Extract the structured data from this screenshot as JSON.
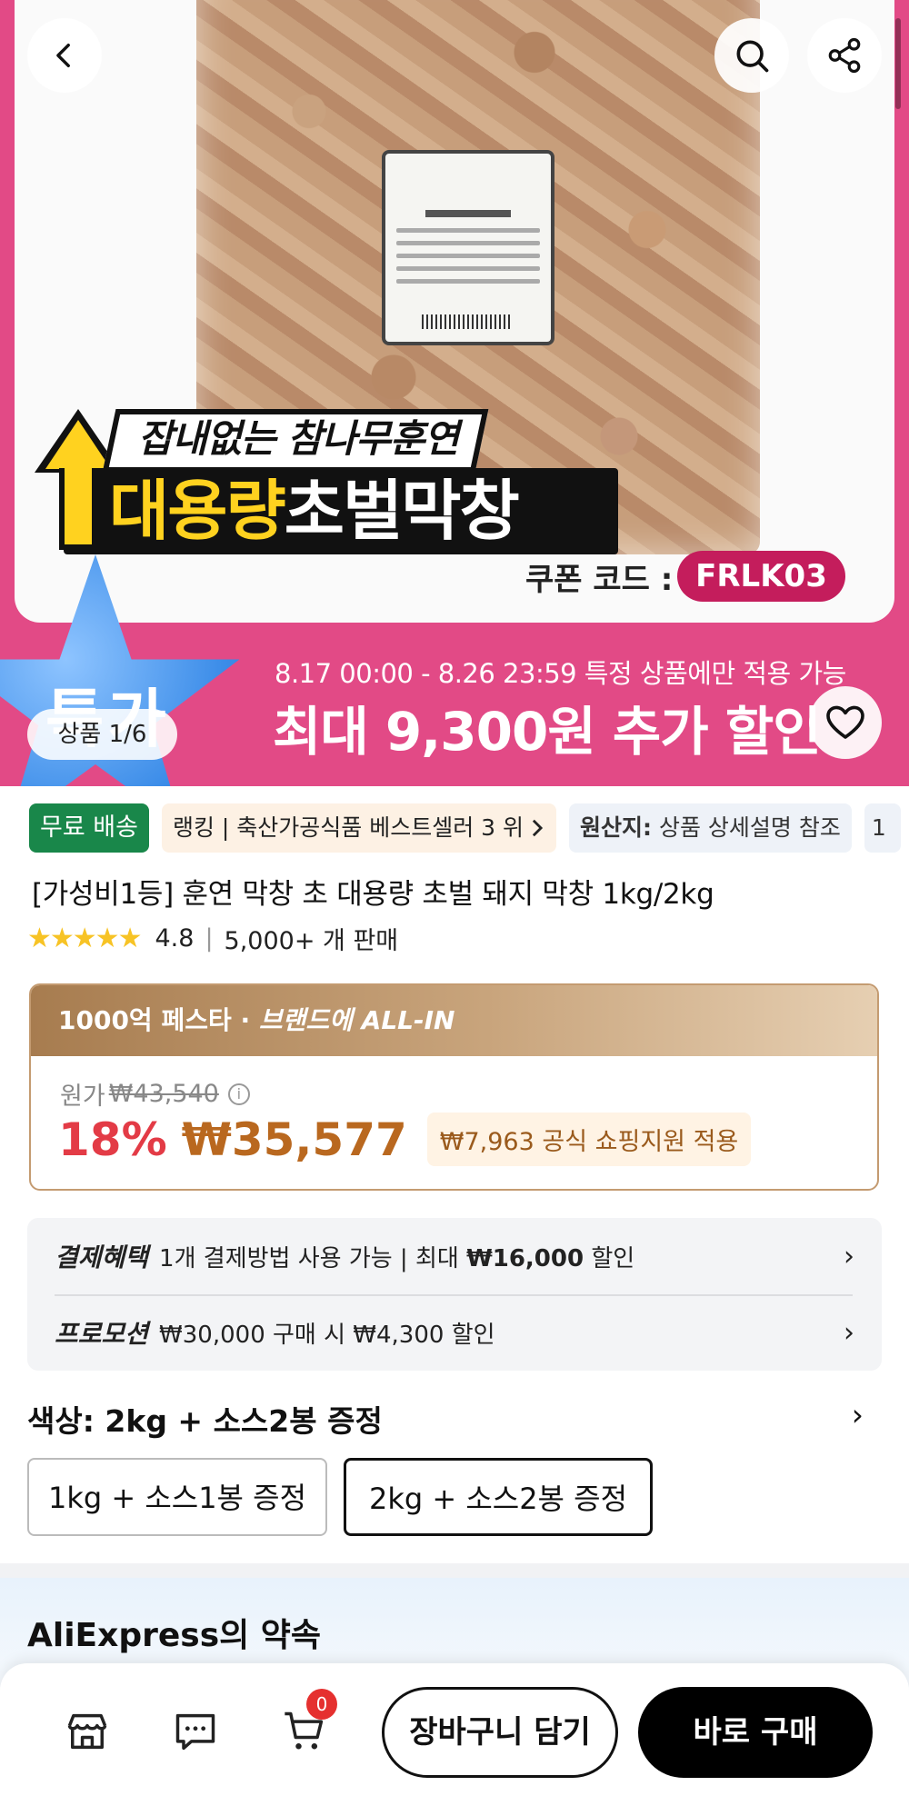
{
  "hero": {
    "headline_small": "잡내없는 참나무훈연",
    "headline_yellow": "대용량",
    "headline_white": "초벌막창",
    "coupon_label": "쿠폰 코드 :",
    "coupon_code": "FRLK03",
    "star_text": "특가",
    "promo_date": "8.17 00:00 - 8.26 23:59 특정 상품에만 적용 가능",
    "promo_big": "최대 9,300원 추가 할인",
    "image_counter": "상품 1/6",
    "colors": {
      "background": "#e24a86",
      "coupon": "#c41d5c",
      "headline_yellow": "#ffd21f"
    }
  },
  "icons": {
    "back": "chevron-left-icon",
    "search": "search-icon",
    "share": "share-icon",
    "wishlist": "heart-icon",
    "store": "store-icon",
    "chat": "chat-icon",
    "cart": "cart-icon"
  },
  "tags": {
    "free_shipping": "무료 배송",
    "ranking": "랭킹 | 축산가공식품 베스트셀러 3 위",
    "origin_label": "원산지:",
    "origin_value": "상품 상세설명 참조",
    "more": "1"
  },
  "product": {
    "title": "[가성비1등] 훈연 막창 초 대용량 초벌 돼지 막창 1kg/2kg",
    "rating": "4.8",
    "rating_stars": 4.8,
    "sold": "5,000+ 개 판매"
  },
  "price": {
    "festa_prefix": "1000억 페스타 · ",
    "festa_brand": "브랜드에 ALL-IN",
    "original_label": "원가",
    "original_price": "₩43,540",
    "discount": "18%",
    "current_price": "₩35,577",
    "support": "₩7,963 공식 쇼핑지원 적용",
    "colors": {
      "discount": "#e33b46",
      "price": "#b9681f"
    }
  },
  "benefits": {
    "payment_label": "결제혜택",
    "payment_text_1": "1개 결제방법 사용 가능 | 최대 ",
    "payment_amount": "₩16,000",
    "payment_text_2": " 할인",
    "promotion_label": "프로모션",
    "promotion_text": "₩30,000 구매 시 ₩4,300 할인"
  },
  "options": {
    "heading": "색상: 2kg + 소스2봉 증정",
    "items": [
      "1kg + 소스1봉 증정",
      "2kg + 소스2봉 증정"
    ],
    "selected": "2kg + 소스2봉 증정"
  },
  "promise": {
    "title": "AliExpress의 약속"
  },
  "bottom_bar": {
    "cart_count": "0",
    "add_to_cart": "장바구니 담기",
    "buy_now": "바로 구매"
  }
}
